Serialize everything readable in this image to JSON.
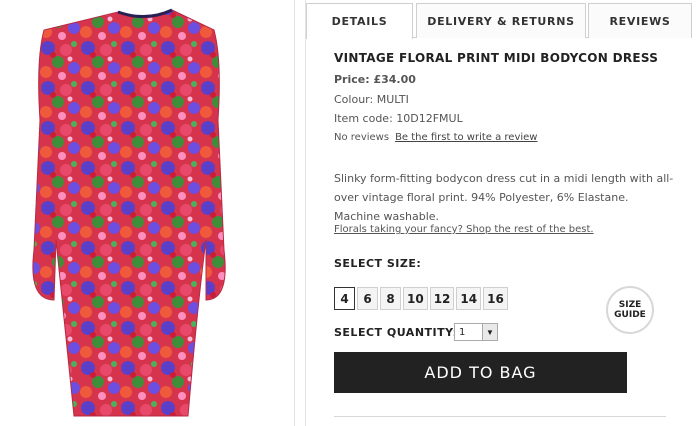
{
  "tabs": [
    {
      "label": "DETAILS"
    },
    {
      "label": "DELIVERY & RETURNS"
    },
    {
      "label": "REVIEWS"
    }
  ],
  "product": {
    "title": "VINTAGE FLORAL PRINT MIDI BODYCON DRESS",
    "price": "Price: £34.00",
    "colour": "Colour: MULTI",
    "item_code": "Item code: 10D12FMUL",
    "reviews_count": "No reviews",
    "review_link": "Be the first to write a review",
    "description": "Slinky form-fitting bodycon dress cut in a midi length with all-over vintage floral print. 94% Polyester, 6% Elastane. Machine washable.",
    "promo_link": "Florals taking your fancy? Shop the rest of the best."
  },
  "size": {
    "label": "SELECT SIZE:",
    "options": [
      "4",
      "6",
      "8",
      "10",
      "12",
      "14",
      "16"
    ],
    "selected": "4",
    "guide_line1": "SIZE",
    "guide_line2": "GUIDE"
  },
  "quantity": {
    "label": "SELECT QUANTITY:",
    "value": "1"
  },
  "add_to_bag": "ADD TO BAG"
}
